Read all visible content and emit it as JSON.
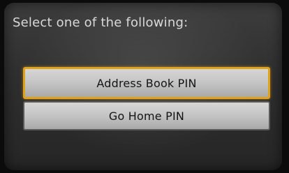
{
  "screen": {
    "prompt": "Select one of the following:"
  },
  "menu": {
    "options": [
      {
        "label": "Address Book PIN",
        "selected": true
      },
      {
        "label": "Go Home PIN",
        "selected": false
      }
    ]
  },
  "colors": {
    "highlight": "#e0a11b",
    "button_face": "#c4c4c4",
    "background": "#2f2f2f",
    "prompt_text": "#d9d9d9"
  }
}
